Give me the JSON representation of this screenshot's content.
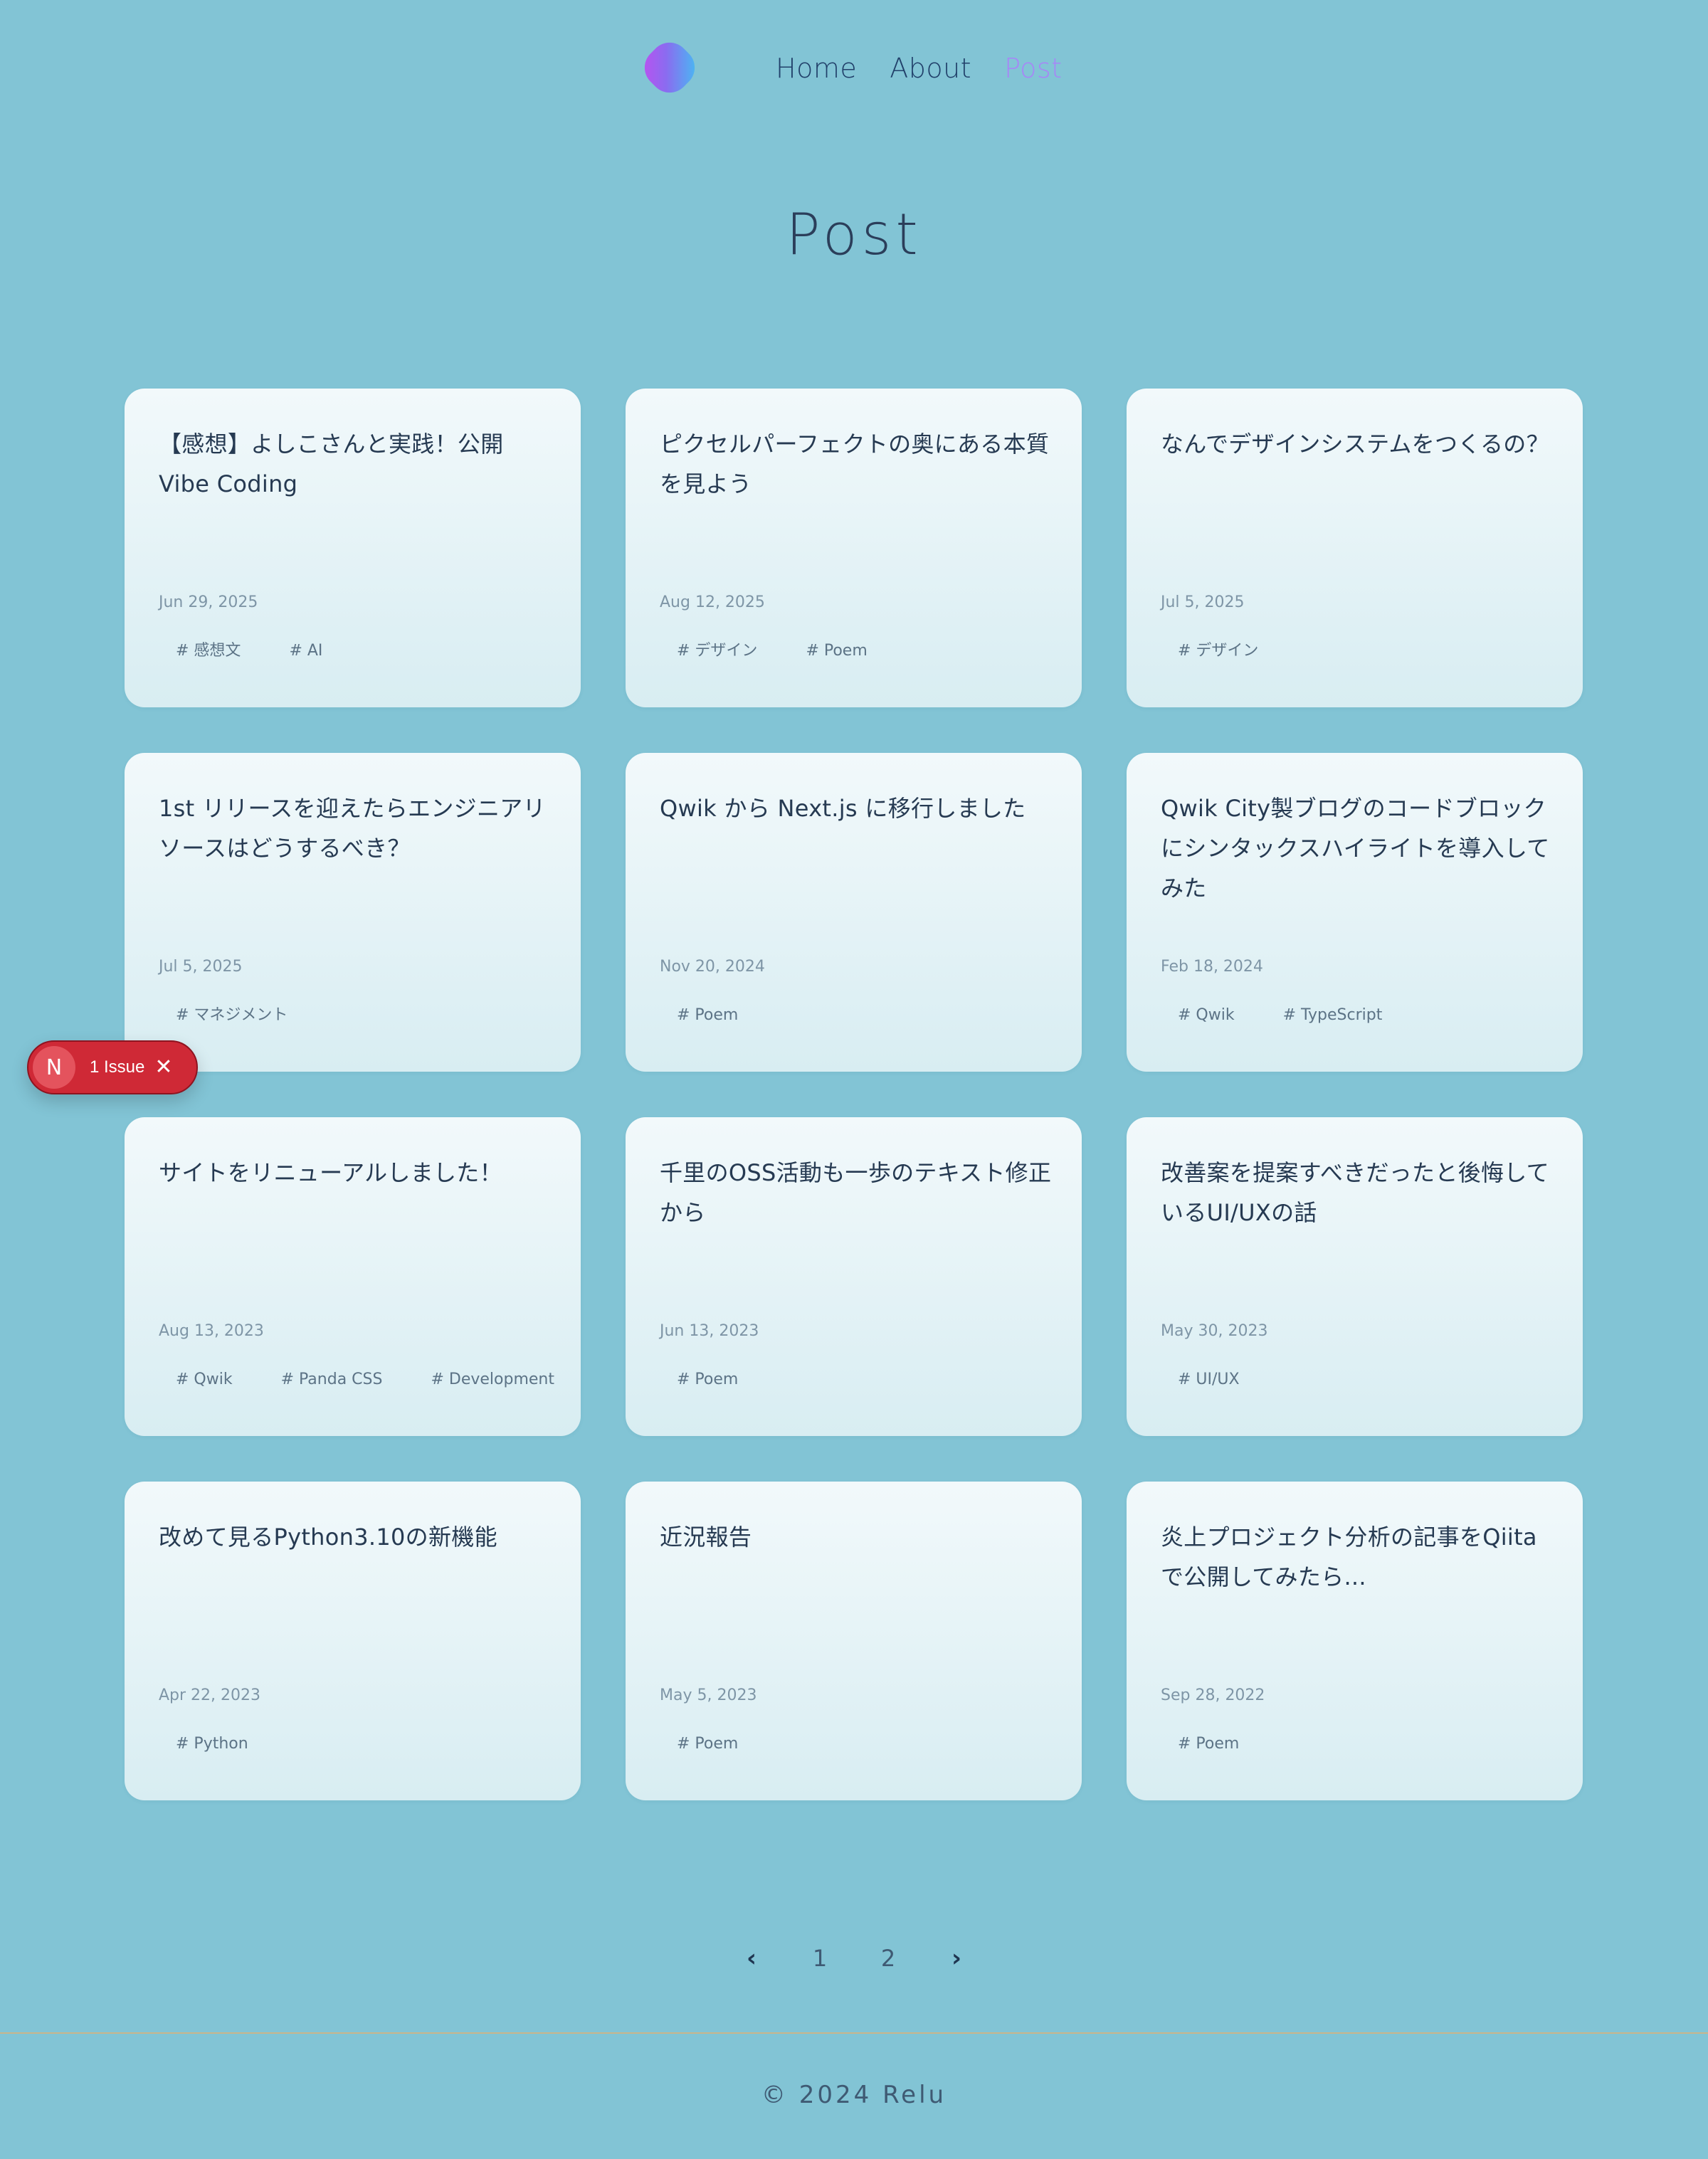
{
  "nav": {
    "logo_label": "",
    "items": [
      "Home",
      "About",
      "Post"
    ],
    "active": "Post"
  },
  "page": {
    "title": "Post"
  },
  "posts": [
    {
      "title": "【感想】よしこさんと実践！公開 Vibe Coding",
      "date": "Jun 29, 2025",
      "tags": [
        "# 感想文",
        "# AI"
      ]
    },
    {
      "title": "ピクセルパーフェクトの奥にある本質を見よう",
      "date": "Aug 12, 2025",
      "tags": [
        "# デザイン",
        "# Poem"
      ]
    },
    {
      "title": "なんでデザインシステムをつくるの？",
      "date": "Jul 5, 2025",
      "tags": [
        "# デザイン"
      ]
    },
    {
      "title": "1st リリースを迎えたらエンジニアリソースはどうするべき？",
      "date": "Jul 5, 2025",
      "tags": [
        "# マネジメント"
      ]
    },
    {
      "title": "Qwik から Next.js に移行しました",
      "date": "Nov 20, 2024",
      "tags": [
        "# Poem"
      ]
    },
    {
      "title": "Qwik City製ブログのコードブロックにシンタックスハイライトを導入してみた",
      "date": "Feb 18, 2024",
      "tags": [
        "# Qwik",
        "# TypeScript"
      ]
    },
    {
      "title": "サイトをリニューアルしました！",
      "date": "Aug 13, 2023",
      "tags": [
        "# Qwik",
        "# Panda CSS",
        "# Development"
      ]
    },
    {
      "title": "千里のOSS活動も一歩のテキスト修正から",
      "date": "Jun 13, 2023",
      "tags": [
        "# Poem"
      ]
    },
    {
      "title": "改善案を提案すべきだったと後悔しているUI/UXの話",
      "date": "May 30, 2023",
      "tags": [
        "# UI/UX"
      ]
    },
    {
      "title": "改めて見るPython3.10の新機能",
      "date": "Apr 22, 2023",
      "tags": [
        "# Python"
      ]
    },
    {
      "title": "近況報告",
      "date": "May 5, 2023",
      "tags": [
        "# Poem"
      ]
    },
    {
      "title": "炎上プロジェクト分析の記事をQiitaで公開してみたら...",
      "date": "Sep 28, 2022",
      "tags": [
        "# Poem"
      ]
    }
  ],
  "pagination": {
    "prev_icon": "chevron-left-icon",
    "next_icon": "chevron-right-icon",
    "prev_glyph": "‹",
    "next_glyph": "›",
    "pages": [
      "1",
      "2"
    ]
  },
  "issue_badge": {
    "letter": "N",
    "text": "1 Issue",
    "close_glyph": "✕"
  },
  "footer": {
    "text": "© 2024 Relu"
  },
  "colors": {
    "background": "#82c4d5",
    "nav_active": "#a786f7",
    "card_top": "#f2f9fb",
    "card_bottom": "#d8edf2",
    "badge": "#cf2936",
    "footer_line": "#c9b58b"
  }
}
